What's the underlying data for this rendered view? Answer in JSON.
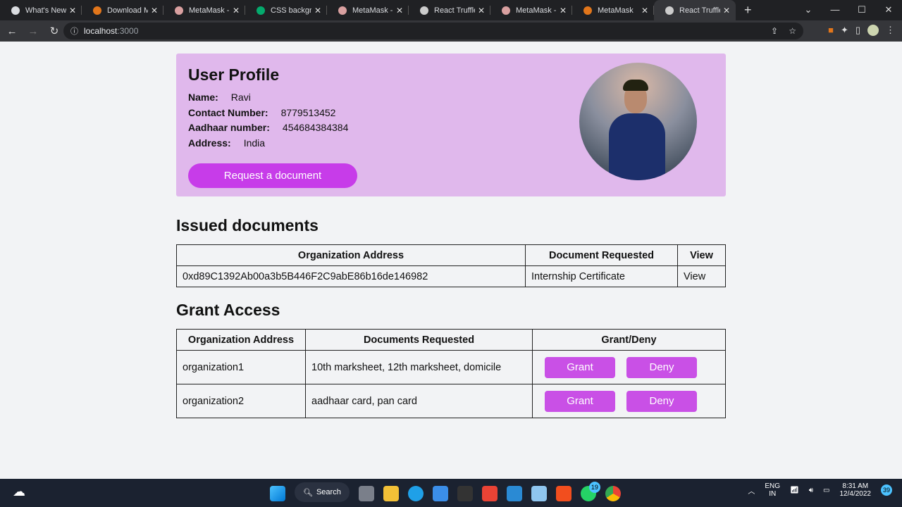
{
  "browser": {
    "tabs": [
      {
        "title": "What's New",
        "color": "#dadce0"
      },
      {
        "title": "Download Me",
        "color": "#e2761b"
      },
      {
        "title": "MetaMask - C",
        "color": "#d9a0a0"
      },
      {
        "title": "CSS backgrou",
        "color": "#04aa6d"
      },
      {
        "title": "MetaMask - C",
        "color": "#d9a0a0"
      },
      {
        "title": "React Truffle B",
        "color": "#cccccc"
      },
      {
        "title": "MetaMask - C",
        "color": "#d9a0a0"
      },
      {
        "title": "MetaMask",
        "color": "#e2761b"
      },
      {
        "title": "React Truffle B",
        "color": "#cccccc",
        "active": true
      }
    ],
    "url_host": "localhost",
    "url_port": ":3000"
  },
  "profile": {
    "title": "User Profile",
    "fields": [
      {
        "label": "Name:",
        "value": "Ravi"
      },
      {
        "label": "Contact Number:",
        "value": "8779513452"
      },
      {
        "label": "Aadhaar number:",
        "value": "454684384384"
      },
      {
        "label": "Address:",
        "value": "India"
      }
    ],
    "request_button": "Request a document"
  },
  "issued": {
    "title": "Issued documents",
    "headers": [
      "Organization Address",
      "Document Requested",
      "View"
    ],
    "rows": [
      [
        "0xd89C1392Ab00a3b5B446F2C9abE86b16de146982",
        "Internship Certificate",
        "View"
      ]
    ]
  },
  "grant": {
    "title": "Grant Access",
    "headers": [
      "Organization Address",
      "Documents Requested",
      "Grant/Deny"
    ],
    "rows": [
      {
        "org": "organization1",
        "docs": "10th marksheet, 12th marksheet, domicile"
      },
      {
        "org": "organization2",
        "docs": "aadhaar card, pan card"
      }
    ],
    "grant_label": "Grant",
    "deny_label": "Deny",
    "accent": "#c950e6"
  },
  "taskbar": {
    "search": "Search",
    "whatsapp_badge": "19",
    "lang1": "ENG",
    "lang2": "IN",
    "time": "8:31 AM",
    "date": "12/4/2022",
    "notif": "39"
  }
}
